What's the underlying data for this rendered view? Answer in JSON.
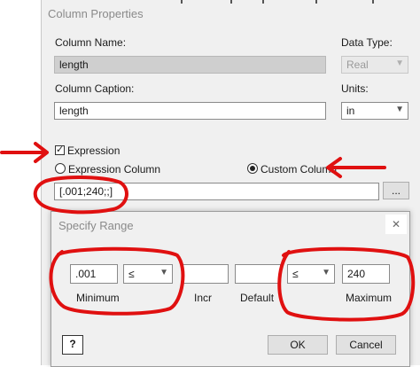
{
  "colors": {
    "annotation": "#e01010",
    "window_bg": "#f0f0f0",
    "disabled_field": "#cfcfcf"
  },
  "column_properties": {
    "title": "Column Properties",
    "column_name_label": "Column Name:",
    "column_name_value": "length",
    "data_type_label": "Data Type:",
    "data_type_value": "Real",
    "column_caption_label": "Column Caption:",
    "column_caption_value": "length",
    "units_label": "Units:",
    "units_value": "in",
    "expression_label": "Expression",
    "expression_checked": true,
    "expression_column_label": "Expression Column",
    "custom_column_label": "Custom Column",
    "selected_mode": "custom_column",
    "expression_value": "[.001;240;;]",
    "browse_label": "..."
  },
  "specify_range": {
    "title": "Specify Range",
    "close_label": "✕",
    "minimum_value": ".001",
    "minimum_operator": "≤",
    "minimum_label": "Minimum",
    "incr_value": "",
    "incr_label": "Incr",
    "default_value": "",
    "default_label": "Default",
    "maximum_operator": "≤",
    "maximum_value": "240",
    "maximum_label": "Maximum",
    "help_label": "?",
    "ok_label": "OK",
    "cancel_label": "Cancel"
  }
}
